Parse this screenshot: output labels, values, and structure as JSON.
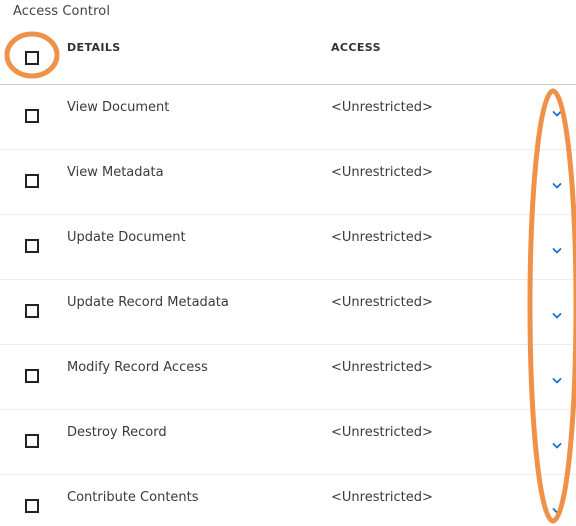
{
  "section": {
    "title": "Access Control"
  },
  "table": {
    "columns": {
      "details": "DETAILS",
      "access": "ACCESS"
    },
    "rows": [
      {
        "details": "View Document",
        "access": "<Unrestricted>"
      },
      {
        "details": "View Metadata",
        "access": "<Unrestricted>"
      },
      {
        "details": "Update Document",
        "access": "<Unrestricted>"
      },
      {
        "details": "Update Record Metadata",
        "access": "<Unrestricted>"
      },
      {
        "details": "Modify Record Access",
        "access": "<Unrestricted>"
      },
      {
        "details": "Destroy Record",
        "access": "<Unrestricted>"
      },
      {
        "details": "Contribute Contents",
        "access": "<Unrestricted>"
      }
    ]
  },
  "icons": {
    "expand": "chevron-down-icon",
    "select": "checkbox-icon"
  },
  "colors": {
    "accent_blue": "#1f6fd0",
    "annotation_orange": "#f0914a"
  }
}
